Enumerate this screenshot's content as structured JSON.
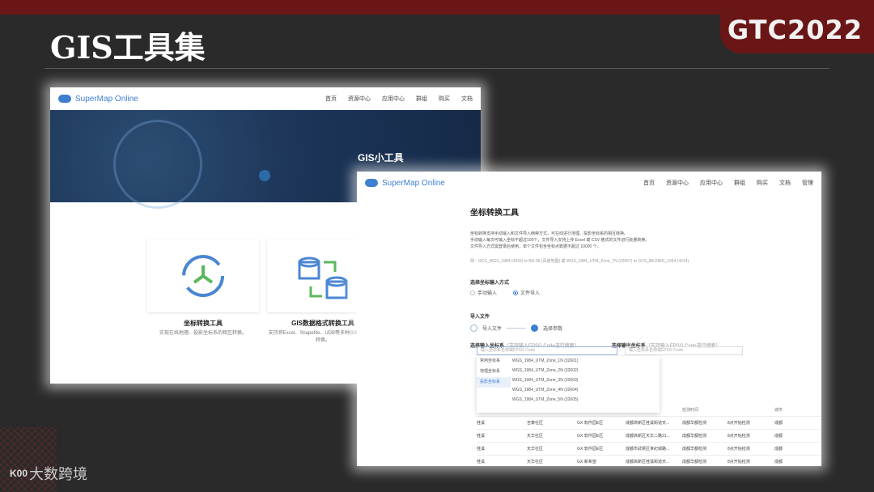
{
  "slide": {
    "title": "GIS工具集",
    "brand": "GTC2022",
    "footer_brand": "大数跨境",
    "footer_badge": "K00"
  },
  "shotA": {
    "logo": "SuperMap Online",
    "nav": [
      "首页",
      "资源中心",
      "应用中心",
      "群组",
      "购买",
      "文档"
    ],
    "hero_title": "GIS小工具",
    "cards": [
      {
        "name": "坐标转换工具",
        "desc": "实现在线地理、投影坐标系的相互转换。"
      },
      {
        "name": "GIS数据格式转换工具",
        "desc": "支持将Excel、Shapefile、UDB等多种GIS格式进行转换。"
      }
    ]
  },
  "shotB": {
    "logo": "SuperMap Online",
    "nav": [
      "首页",
      "资源中心",
      "应用中心",
      "群组",
      "购买",
      "文档",
      "管理"
    ],
    "title": "坐标转换工具",
    "bullets": [
      "坐标转换支持手动输入和文件导入两种方式，可在线进行地理、投影坐标系的相互转换。",
      "手动输入每次可输入坐标不超过100个，文件导入支持上传 Excel 或 CSV 格式的文件进行批量转换。",
      "文件导入方式需登录后使用，单个文件包含坐标点数据不超过 10000 个。"
    ],
    "example": "例：GCS_WGS_1984 (4326) to BD-09 (百度地图) 或 WGS_1984_UTM_Zone_7N (32607) to GCS_BEIJING_1954 (4214)",
    "input_mode_label": "选择坐标输入方式",
    "mode_manual": "手动输入",
    "mode_file": "文件导入",
    "import_label": "导入文件",
    "step1": "导入文件",
    "step2": "选择参数",
    "input_crs_label": "选择输入坐标系",
    "input_crs_hint": "（支持输入EPSG Code进行搜索）",
    "input_placeholder": "输入坐标系名称或EPSG Code",
    "output_crs_label": "选择输出坐标系",
    "output_crs_hint": "（支持输入EPSG Code进行搜索）",
    "output_placeholder": "输入坐标系名称或EPSG Code",
    "dd_categories": [
      "常用坐标系",
      "地理坐标系",
      "投影坐标系"
    ],
    "dd_options": [
      "WGS_1984_UTM_Zone_1N (32601)",
      "WGS_1984_UTM_Zone_2N (32602)",
      "WGS_1984_UTM_Zone_3N (32603)",
      "WGS_1984_UTM_Zone_4N (32604)",
      "WGS_1984_UTM_Zone_5N (32605)"
    ],
    "table_headers": [
      "",
      "",
      "",
      "检测机构",
      "检测时间",
      "城市"
    ],
    "table_rows": [
      [
        "桂溪",
        "吉泰社区",
        "GX·软件园E区",
        "成都高新区桂溪街道天...",
        "成都华都检测",
        "8点开始检测",
        "成都"
      ],
      [
        "桂溪",
        "天华社区",
        "GX·软件园E区",
        "成都高新区天华二路21...",
        "成都华都检测",
        "8点开始检测",
        "成都"
      ],
      [
        "桂溪",
        "天华社区",
        "GX·软件园E区",
        "成都市武侯区世纪城路...",
        "成都华都检测",
        "8点开始检测",
        "成都"
      ],
      [
        "桂溪",
        "天华社区",
        "GX·新希望",
        "成都高新区桂溪街道天...",
        "成都华都检测",
        "8点开始检测",
        "成都"
      ]
    ]
  }
}
